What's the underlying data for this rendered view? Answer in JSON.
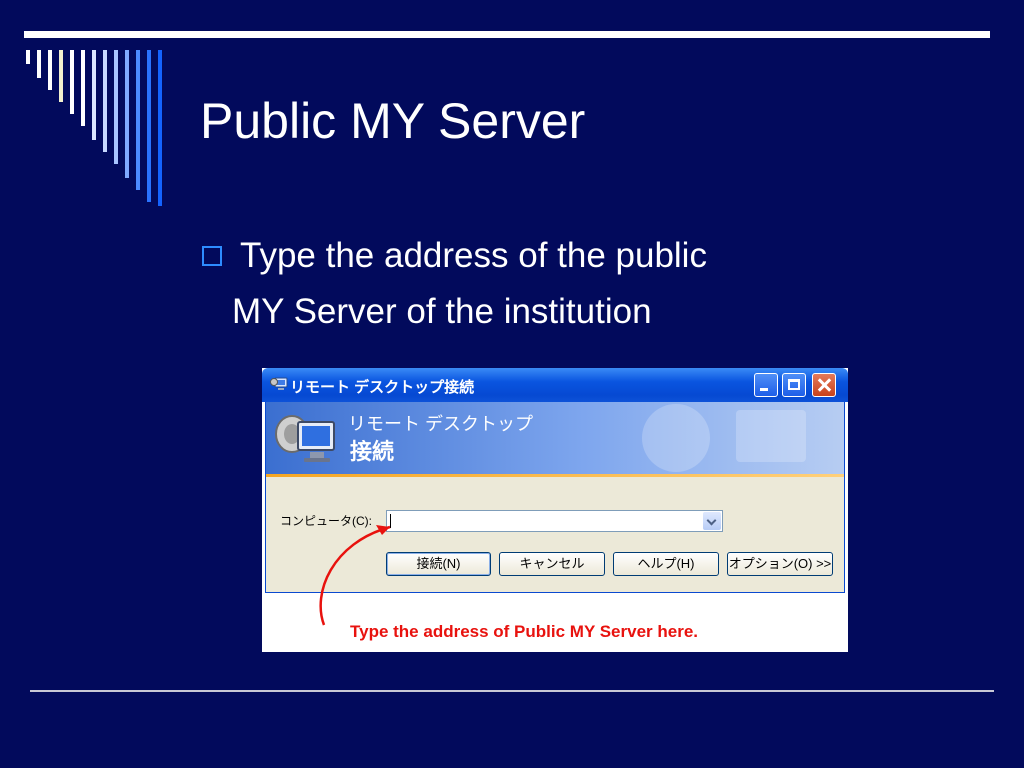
{
  "slide": {
    "title": "Public MY Server",
    "bullet": {
      "line1": "Type the address of the public",
      "line2": "MY Server of the institution"
    }
  },
  "dialog": {
    "window_title": "リモート デスクトップ接続",
    "banner_line1": "リモート デスクトップ",
    "banner_line2": "接続",
    "computer_label": "コンピュータ(C):",
    "computer_value": "",
    "buttons": {
      "connect": "接続(N)",
      "cancel": "キャンセル",
      "help": "ヘルプ(H)",
      "options": "オプション(O) >>"
    }
  },
  "annotation": {
    "text": "Type the address of Public MY Server here."
  },
  "colors": {
    "background": "#020a5c",
    "bullet_box": "#2e8cff",
    "annotation": "#e8120e",
    "xp_title_bar": "#0a55e0"
  },
  "icons": [
    "remote-desktop-icon",
    "minimize-icon",
    "maximize-icon",
    "close-icon",
    "dropdown-arrow-icon",
    "red-arrow-icon"
  ]
}
